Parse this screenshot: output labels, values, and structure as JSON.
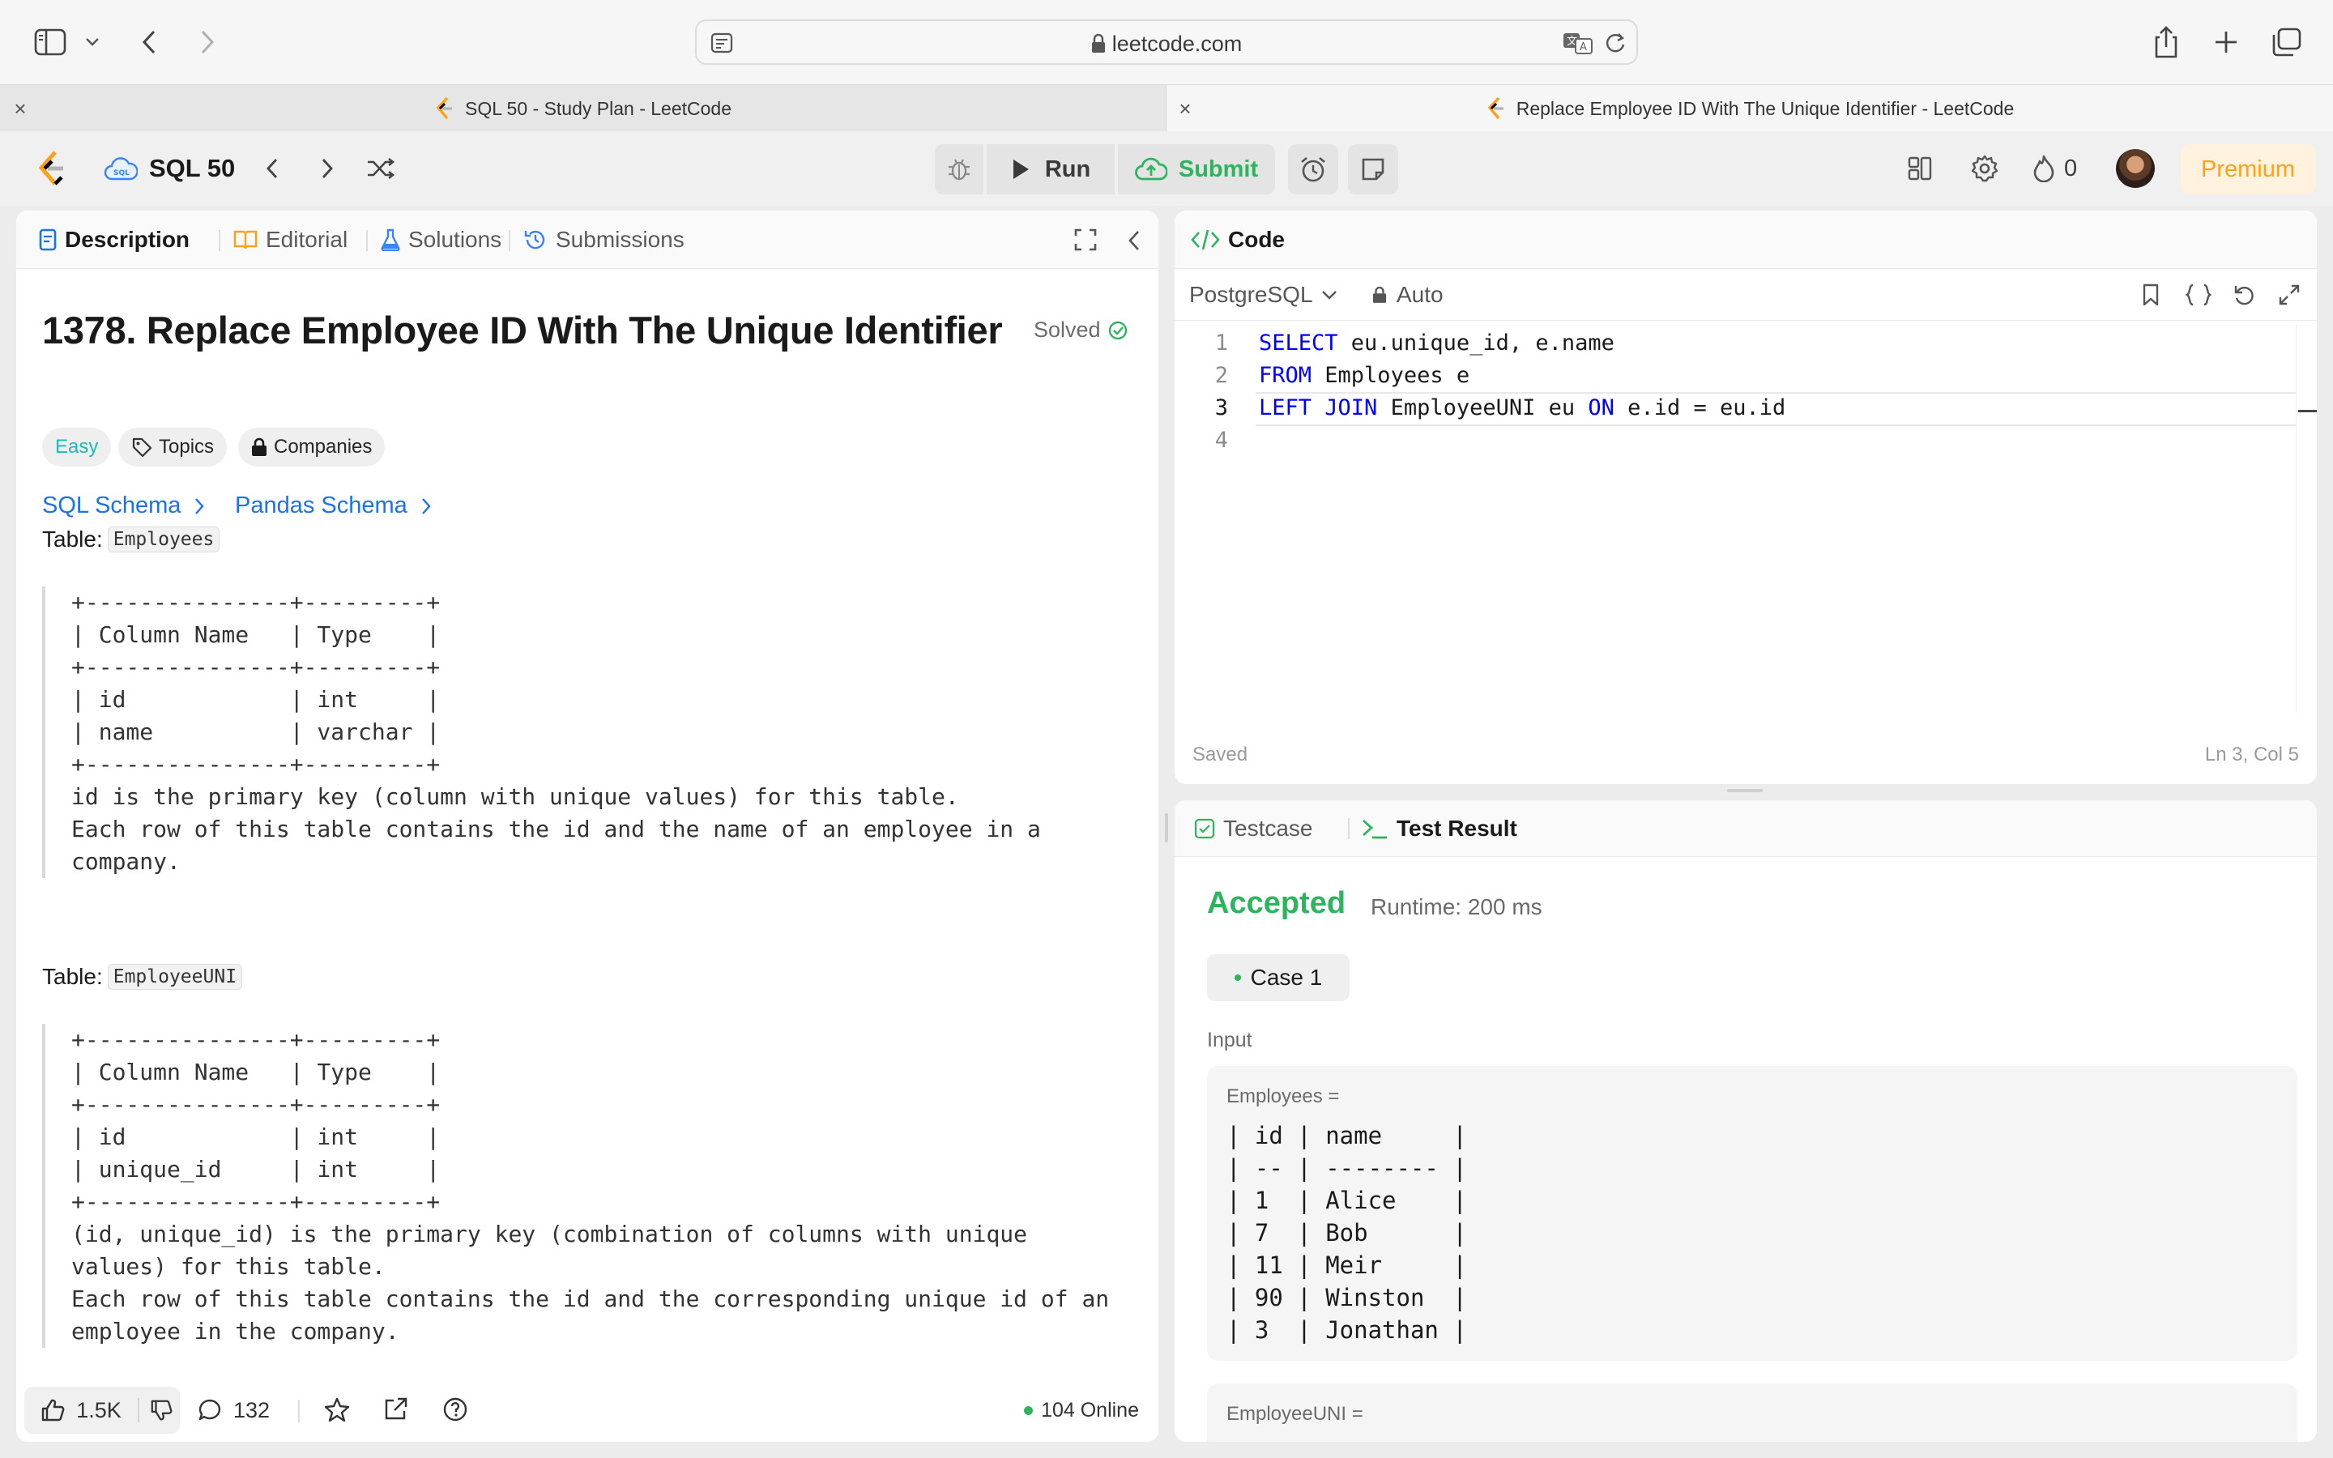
{
  "browser": {
    "url": "leetcode.com",
    "tabs": [
      {
        "title": "SQL 50 - Study Plan - LeetCode"
      },
      {
        "title": "Replace Employee ID With The Unique Identifier - LeetCode"
      }
    ]
  },
  "nav": {
    "study_plan": "SQL 50",
    "run_label": "Run",
    "submit_label": "Submit",
    "streak_count": "0",
    "premium_label": "Premium"
  },
  "description_panel": {
    "tabs": [
      {
        "label": "Description"
      },
      {
        "label": "Editorial"
      },
      {
        "label": "Solutions"
      },
      {
        "label": "Submissions"
      }
    ],
    "title": "1378. Replace Employee ID With The Unique Identifier",
    "solved_label": "Solved",
    "difficulty": "Easy",
    "topics_label": "Topics",
    "companies_label": "Companies",
    "sql_schema_label": "SQL Schema",
    "pandas_schema_label": "Pandas Schema",
    "table1_prefix": "Table:",
    "table1_name": "Employees",
    "table1_schema": "+---------------+---------+\n| Column Name   | Type    |\n+---------------+---------+\n| id            | int     |\n| name          | varchar |\n+---------------+---------+\nid is the primary key (column with unique values) for this table.\nEach row of this table contains the id and the name of an employee in a\ncompany.",
    "table2_prefix": "Table:",
    "table2_name": "EmployeeUNI",
    "table2_schema": "+---------------+---------+\n| Column Name   | Type    |\n+---------------+---------+\n| id            | int     |\n| unique_id     | int     |\n+---------------+---------+\n(id, unique_id) is the primary key (combination of columns with unique\nvalues) for this table.\nEach row of this table contains the id and the corresponding unique id of an\nemployee in the company.",
    "likes": "1.5K",
    "comments": "132",
    "online": "104 Online"
  },
  "code_panel": {
    "tab_label": "Code",
    "language": "PostgreSQL",
    "mode": "Auto",
    "lines": [
      {
        "n": "1",
        "tokens": [
          {
            "t": "SELECT",
            "kw": true
          },
          {
            "t": " eu.unique_id, e.name",
            "kw": false
          }
        ]
      },
      {
        "n": "2",
        "tokens": [
          {
            "t": "FROM",
            "kw": true
          },
          {
            "t": " Employees e",
            "kw": false
          }
        ]
      },
      {
        "n": "3",
        "tokens": [
          {
            "t": "LEFT JOIN",
            "kw": true
          },
          {
            "t": " EmployeeUNI eu ",
            "kw": false
          },
          {
            "t": "ON",
            "kw": true
          },
          {
            "t": " e.id = eu.id",
            "kw": false
          }
        ]
      },
      {
        "n": "4",
        "tokens": []
      }
    ],
    "saved_label": "Saved",
    "cursor_pos": "Ln 3, Col 5"
  },
  "result_panel": {
    "tabs": [
      {
        "label": "Testcase"
      },
      {
        "label": "Test Result"
      }
    ],
    "status": "Accepted",
    "runtime": "Runtime: 200 ms",
    "case_label": "Case 1",
    "input_label": "Input",
    "employees_label": "Employees =",
    "employees_table": "| id | name     |\n| -- | -------- |\n| 1  | Alice    |\n| 7  | Bob      |\n| 11 | Meir     |\n| 90 | Winston  |\n| 3  | Jonathan |",
    "employeeuni_label": "EmployeeUNI ="
  },
  "colors": {
    "accent_orange": "#ffa116",
    "easy_teal": "#1cbaba",
    "accepted_green": "#2db55d",
    "link_blue": "#1a73e8",
    "keyword_blue": "#0000ff"
  }
}
